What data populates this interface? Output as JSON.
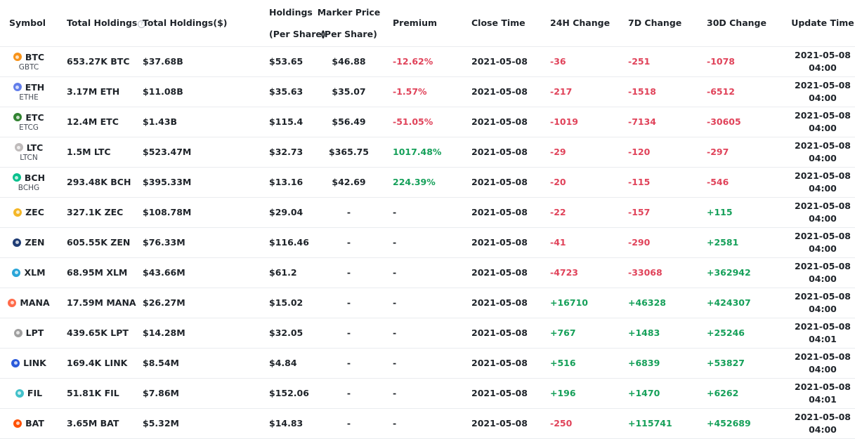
{
  "headers": {
    "symbol": "Symbol",
    "total_holdings": "Total Holdings",
    "total_holdings_usd": "Total Holdings($)",
    "holdings_l1": "Holdings",
    "holdings_l2": "(Per Share)",
    "marker_l1": "Marker Price",
    "marker_l2": "(Per Share)",
    "premium": "Premium",
    "close_time": "Close Time",
    "change_24h": "24H Change",
    "change_7d": "7D Change",
    "change_30d": "30D Change",
    "update_time": "Update Time"
  },
  "rows": [
    {
      "symbol": "BTC",
      "sub": "GBTC",
      "icon": "btc-icon",
      "color": "#f7931a",
      "holdings": "653.27K BTC",
      "holdings_usd": "$37.68B",
      "per_share": "$53.65",
      "market": "$46.88",
      "premium": "-12.62%",
      "close": "2021-05-08",
      "c24": "-36",
      "c7": "-251",
      "c30": "-1078",
      "upd_date": "2021-05-08",
      "upd_time": "04:00"
    },
    {
      "symbol": "ETH",
      "sub": "ETHE",
      "icon": "eth-icon",
      "color": "#627eea",
      "holdings": "3.17M ETH",
      "holdings_usd": "$11.08B",
      "per_share": "$35.63",
      "market": "$35.07",
      "premium": "-1.57%",
      "close": "2021-05-08",
      "c24": "-217",
      "c7": "-1518",
      "c30": "-6512",
      "upd_date": "2021-05-08",
      "upd_time": "04:00"
    },
    {
      "symbol": "ETC",
      "sub": "ETCG",
      "icon": "etc-icon",
      "color": "#328332",
      "holdings": "12.4M ETC",
      "holdings_usd": "$1.43B",
      "per_share": "$115.4",
      "market": "$56.49",
      "premium": "-51.05%",
      "close": "2021-05-08",
      "c24": "-1019",
      "c7": "-7134",
      "c30": "-30605",
      "upd_date": "2021-05-08",
      "upd_time": "04:00"
    },
    {
      "symbol": "LTC",
      "sub": "LTCN",
      "icon": "ltc-icon",
      "color": "#bfbbbb",
      "holdings": "1.5M LTC",
      "holdings_usd": "$523.47M",
      "per_share": "$32.73",
      "market": "$365.75",
      "premium": "1017.48%",
      "close": "2021-05-08",
      "c24": "-29",
      "c7": "-120",
      "c30": "-297",
      "upd_date": "2021-05-08",
      "upd_time": "04:00"
    },
    {
      "symbol": "BCH",
      "sub": "BCHG",
      "icon": "bch-icon",
      "color": "#0ac18e",
      "holdings": "293.48K BCH",
      "holdings_usd": "$395.33M",
      "per_share": "$13.16",
      "market": "$42.69",
      "premium": "224.39%",
      "close": "2021-05-08",
      "c24": "-20",
      "c7": "-115",
      "c30": "-546",
      "upd_date": "2021-05-08",
      "upd_time": "04:00"
    },
    {
      "symbol": "ZEC",
      "sub": "",
      "icon": "zec-icon",
      "color": "#f4b728",
      "holdings": "327.1K ZEC",
      "holdings_usd": "$108.78M",
      "per_share": "$29.04",
      "market": "-",
      "premium": "-",
      "close": "2021-05-08",
      "c24": "-22",
      "c7": "-157",
      "c30": "+115",
      "upd_date": "2021-05-08",
      "upd_time": "04:00"
    },
    {
      "symbol": "ZEN",
      "sub": "",
      "icon": "zen-icon",
      "color": "#1f3c74",
      "holdings": "605.55K ZEN",
      "holdings_usd": "$76.33M",
      "per_share": "$116.46",
      "market": "-",
      "premium": "-",
      "close": "2021-05-08",
      "c24": "-41",
      "c7": "-290",
      "c30": "+2581",
      "upd_date": "2021-05-08",
      "upd_time": "04:00"
    },
    {
      "symbol": "XLM",
      "sub": "",
      "icon": "xlm-icon",
      "color": "#2aa5d8",
      "holdings": "68.95M XLM",
      "holdings_usd": "$43.66M",
      "per_share": "$61.2",
      "market": "-",
      "premium": "-",
      "close": "2021-05-08",
      "c24": "-4723",
      "c7": "-33068",
      "c30": "+362942",
      "upd_date": "2021-05-08",
      "upd_time": "04:00"
    },
    {
      "symbol": "MANA",
      "sub": "",
      "icon": "mana-icon",
      "color": "#ff6b4a",
      "holdings": "17.59M MANA",
      "holdings_usd": "$26.27M",
      "per_share": "$15.02",
      "market": "-",
      "premium": "-",
      "close": "2021-05-08",
      "c24": "+16710",
      "c7": "+46328",
      "c30": "+424307",
      "upd_date": "2021-05-08",
      "upd_time": "04:00"
    },
    {
      "symbol": "LPT",
      "sub": "",
      "icon": "lpt-icon",
      "color": "#a0a0a0",
      "holdings": "439.65K LPT",
      "holdings_usd": "$14.28M",
      "per_share": "$32.05",
      "market": "-",
      "premium": "-",
      "close": "2021-05-08",
      "c24": "+767",
      "c7": "+1483",
      "c30": "+25246",
      "upd_date": "2021-05-08",
      "upd_time": "04:01"
    },
    {
      "symbol": "LINK",
      "sub": "",
      "icon": "link-icon",
      "color": "#2a5ada",
      "holdings": "169.4K LINK",
      "holdings_usd": "$8.54M",
      "per_share": "$4.84",
      "market": "-",
      "premium": "-",
      "close": "2021-05-08",
      "c24": "+516",
      "c7": "+6839",
      "c30": "+53827",
      "upd_date": "2021-05-08",
      "upd_time": "04:00"
    },
    {
      "symbol": "FIL",
      "sub": "",
      "icon": "fil-icon",
      "color": "#42c1ca",
      "holdings": "51.81K FIL",
      "holdings_usd": "$7.86M",
      "per_share": "$152.06",
      "market": "-",
      "premium": "-",
      "close": "2021-05-08",
      "c24": "+196",
      "c7": "+1470",
      "c30": "+6262",
      "upd_date": "2021-05-08",
      "upd_time": "04:01"
    },
    {
      "symbol": "BAT",
      "sub": "",
      "icon": "bat-icon",
      "color": "#ff5000",
      "holdings": "3.65M BAT",
      "holdings_usd": "$5.32M",
      "per_share": "$14.83",
      "market": "-",
      "premium": "-",
      "close": "2021-05-08",
      "c24": "-250",
      "c7": "+115741",
      "c30": "+452689",
      "upd_date": "2021-05-08",
      "upd_time": "04:00"
    }
  ]
}
